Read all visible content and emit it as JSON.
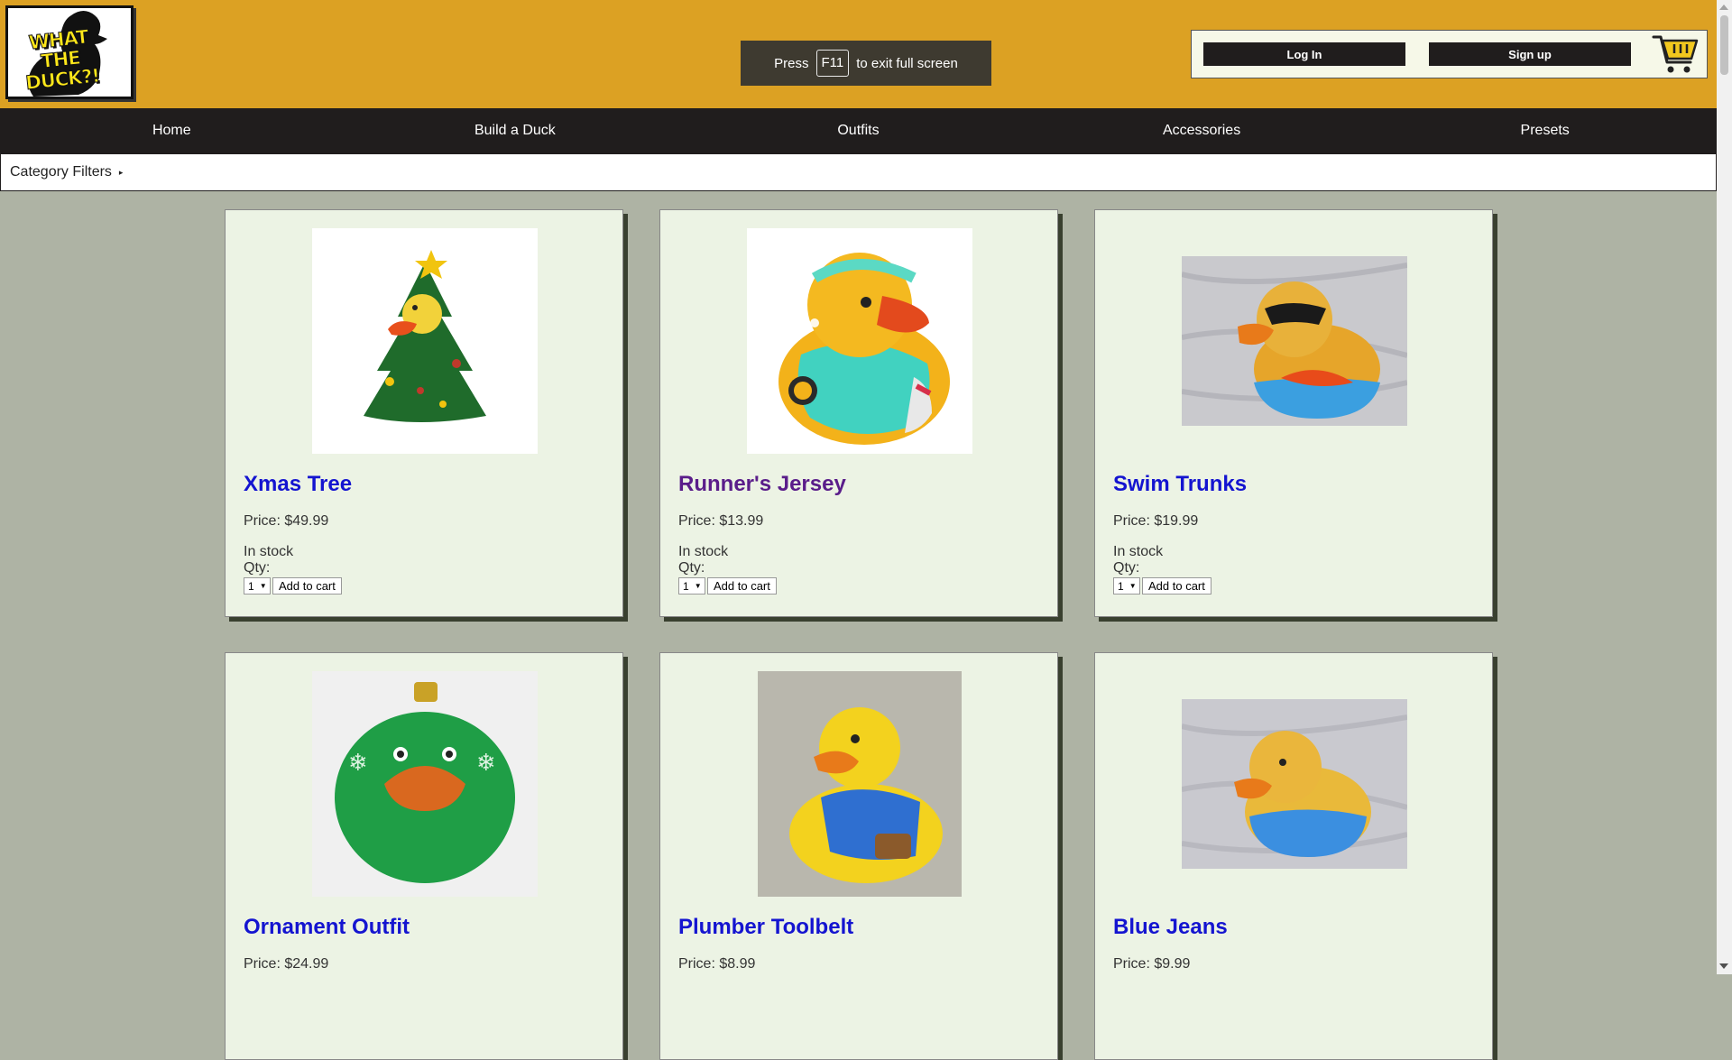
{
  "logo": {
    "text": "WHAT THE DUCK?!"
  },
  "fullscreen_notice": {
    "press": "Press",
    "key": "F11",
    "rest": "to exit full screen"
  },
  "auth": {
    "login": "Log In",
    "signup": "Sign up"
  },
  "nav": {
    "items": [
      "Home",
      "Build a Duck",
      "Outfits",
      "Accessories",
      "Presets"
    ]
  },
  "filters": {
    "label": "Category Filters",
    "icon": "triangle-right-icon"
  },
  "products": [
    {
      "name": "Xmas Tree",
      "price": "Price: $49.99",
      "stock": "In stock",
      "qty_label": "Qty:",
      "qty": "1",
      "button": "Add to cart",
      "image": "christmas-tree-duck"
    },
    {
      "name": "Runner's Jersey",
      "price": "Price: $13.99",
      "stock": "In stock",
      "qty_label": "Qty:",
      "qty": "1",
      "button": "Add to cart",
      "image": "runner-duck"
    },
    {
      "name": "Swim Trunks",
      "price": "Price: $19.99",
      "stock": "In stock",
      "qty_label": "Qty:",
      "qty": "1",
      "button": "Add to cart",
      "image": "swim-duck"
    },
    {
      "name": "Ornament Outfit",
      "price": "Price: $24.99",
      "image": "ornament-duck"
    },
    {
      "name": "Plumber Toolbelt",
      "price": "Price: $8.99",
      "image": "plumber-duck"
    },
    {
      "name": "Blue Jeans",
      "price": "Price: $9.99",
      "image": "jeans-duck"
    }
  ],
  "colors": {
    "header": "#dca123",
    "nav": "#201d1d",
    "page_bg": "#aeb3a4",
    "card_bg": "#ecf3e4",
    "link": "#1414d0",
    "visited_link": "#5a1d8a"
  }
}
